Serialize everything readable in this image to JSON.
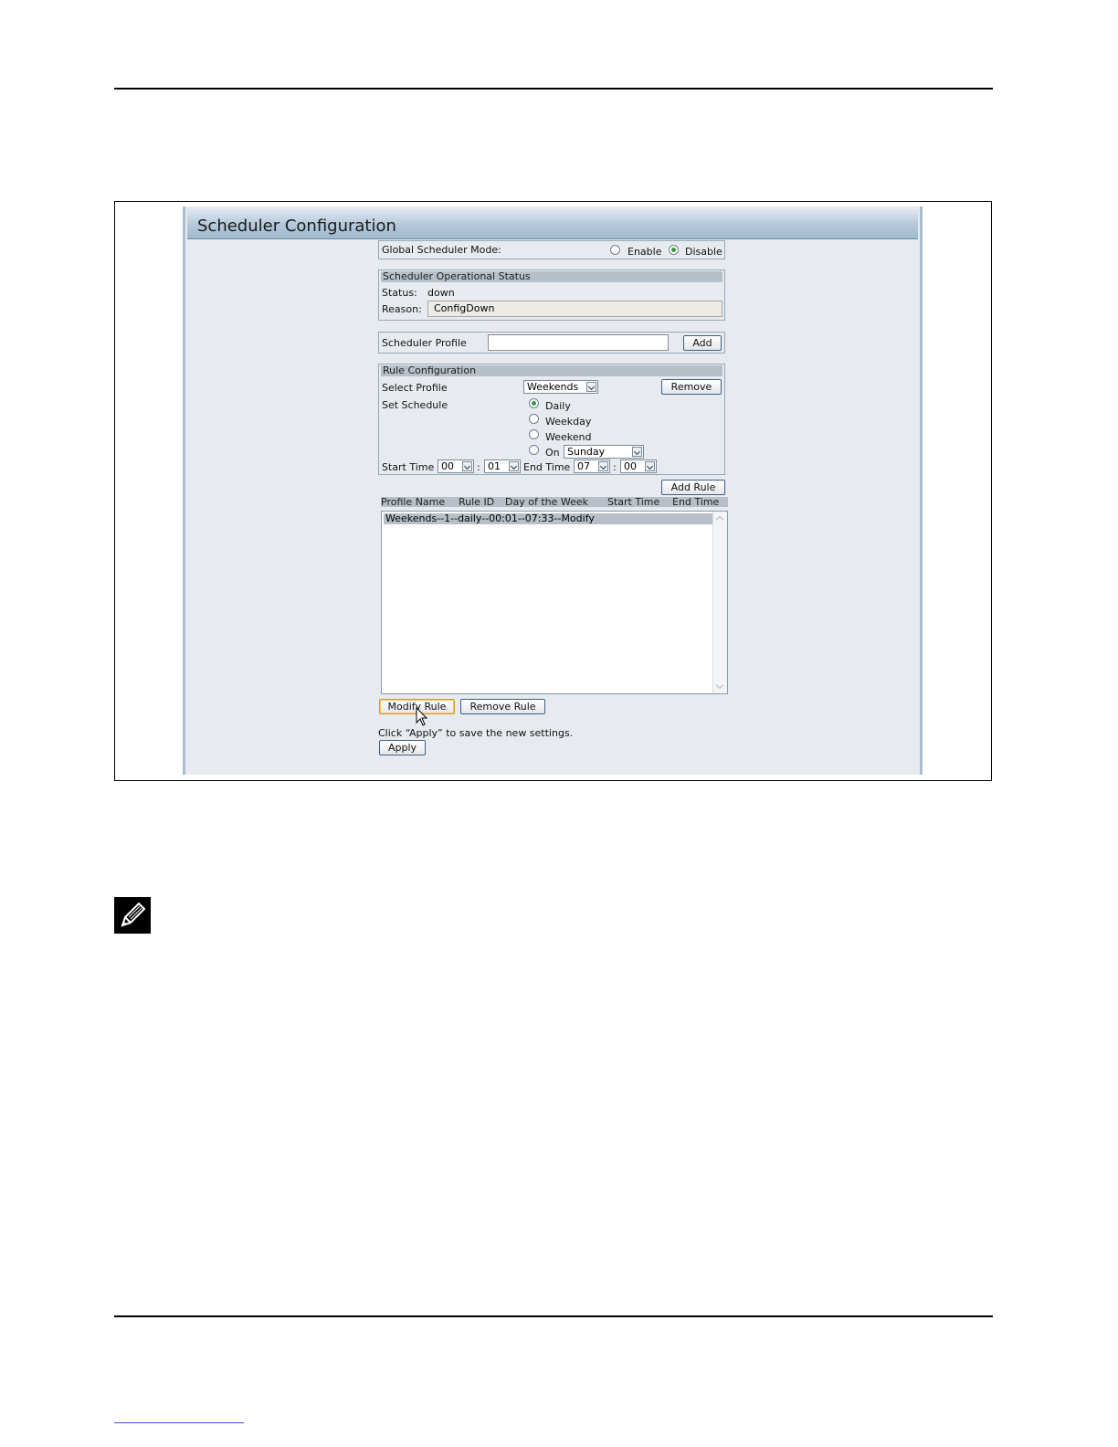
{
  "window": {
    "title": "Scheduler Configuration"
  },
  "global_mode": {
    "label": "Global Scheduler Mode:",
    "options": [
      {
        "label": "Enable",
        "selected": false
      },
      {
        "label": "Disable",
        "selected": true
      }
    ]
  },
  "op_status": {
    "heading": "Scheduler Operational Status",
    "status_label": "Status:",
    "status_value": "down",
    "reason_label": "Reason:",
    "reason_value": "ConfigDown"
  },
  "profile": {
    "label": "Scheduler Profile",
    "input_value": "",
    "add_label": "Add"
  },
  "rule_config": {
    "heading": "Rule Configuration",
    "select_profile_label": "Select Profile",
    "selected_profile": "Weekends",
    "remove_label": "Remove",
    "set_schedule_label": "Set Schedule",
    "schedule_options": [
      {
        "label": "Daily",
        "selected": true
      },
      {
        "label": "Weekday",
        "selected": false
      },
      {
        "label": "Weekend",
        "selected": false
      },
      {
        "label": "On",
        "selected": false
      }
    ],
    "on_day": "Sunday",
    "start_time_label": "Start Time",
    "start_hour": "00",
    "start_min": "01",
    "end_time_label": "End Time",
    "end_hour": "07",
    "end_min": "00",
    "colon": ":",
    "add_rule_label": "Add Rule"
  },
  "rules_table": {
    "columns": [
      "Profile Name",
      "Rule ID",
      "Day of the Week",
      "Start Time",
      "End Time"
    ],
    "rows": [
      "Weekends--1--daily--00:01--07:33--Modify"
    ]
  },
  "actions": {
    "modify_rule_label": "Modify Rule",
    "remove_rule_label": "Remove Rule",
    "hint": "Click “Apply” to save the new settings.",
    "apply_label": "Apply"
  },
  "colors": {
    "title_bar": "#b6cadc",
    "section_header": "#b7bfc8",
    "panel_bg": "#e7ebf0",
    "button_border": "#3e5f86",
    "radio_selected": "#2f9c3a"
  }
}
